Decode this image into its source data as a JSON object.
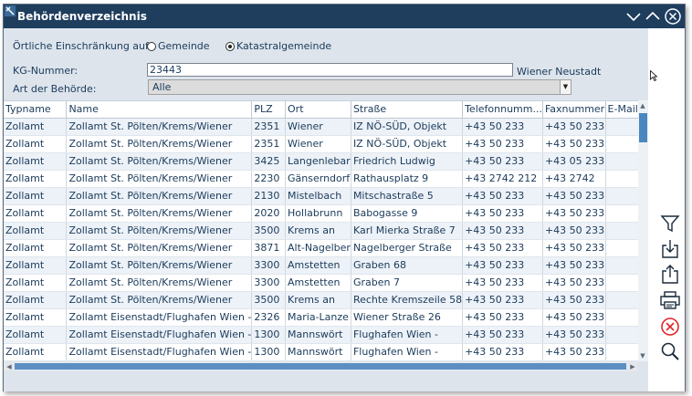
{
  "window": {
    "title": "Behördenverzeichnis"
  },
  "filters": {
    "restriction_label": "Örtliche Einschränkung auf:",
    "radio_gemeinde": "Gemeinde",
    "radio_katastral": "Katastralgemeinde",
    "selected_radio": "Katastralgemeinde",
    "kg_label": "KG-Nummer:",
    "kg_value": "23443",
    "kg_name": "Wiener Neustadt",
    "authority_label": "Art der Behörde:",
    "authority_value": "Alle"
  },
  "table": {
    "columns": [
      "Typname",
      "Name",
      "PLZ",
      "Ort",
      "Straße",
      "Telefonnumm...",
      "Faxnummer",
      "E-Mail"
    ],
    "rows": [
      [
        "Zollamt",
        "Zollamt St. Pölten/Krems/Wiener",
        "2351",
        "Wiener",
        "IZ NÖ-SÜD, Objekt",
        "+43 50 233",
        "+43 50 233",
        ""
      ],
      [
        "Zollamt",
        "Zollamt St. Pölten/Krems/Wiener",
        "2351",
        "Wiener",
        "IZ NÖ-SÜD, Objekt",
        "+43 50 233",
        "+43 50 233",
        ""
      ],
      [
        "Zollamt",
        "Zollamt St. Pölten/Krems/Wiener",
        "3425",
        "Langenlebar",
        "Friedrich Ludwig",
        "+43 50 233",
        "+43 05 233",
        ""
      ],
      [
        "Zollamt",
        "Zollamt St. Pölten/Krems/Wiener",
        "2230",
        "Gänserndorf",
        "Rathausplatz 9",
        "+43 2742 212",
        "+43 2742",
        ""
      ],
      [
        "Zollamt",
        "Zollamt St. Pölten/Krems/Wiener",
        "2130",
        "Mistelbach",
        "Mitschastraße  5",
        "+43 50 233",
        "+43 50 233",
        ""
      ],
      [
        "Zollamt",
        "Zollamt St. Pölten/Krems/Wiener",
        "2020",
        "Hollabrunn",
        "Babogasse 9",
        "+43 50 233",
        "+43 50 233",
        ""
      ],
      [
        "Zollamt",
        "Zollamt St. Pölten/Krems/Wiener",
        "3500",
        "Krems an",
        "Karl Mierka Straße 7",
        "+43 50 233",
        "+43 50 233",
        ""
      ],
      [
        "Zollamt",
        "Zollamt St. Pölten/Krems/Wiener",
        "3871",
        "Alt-Nagelber",
        "Nagelberger Straße",
        "+43 50 233",
        "+43 50 233",
        ""
      ],
      [
        "Zollamt",
        "Zollamt St. Pölten/Krems/Wiener",
        "3300",
        "Amstetten",
        "Graben  68",
        "+43 50 233",
        "+43 50 233",
        ""
      ],
      [
        "Zollamt",
        "Zollamt St. Pölten/Krems/Wiener",
        "3300",
        "Amstetten",
        "Graben 7",
        "+43 50 233",
        "+43 50 233",
        ""
      ],
      [
        "Zollamt",
        "Zollamt St. Pölten/Krems/Wiener",
        "3500",
        "Krems an",
        "Rechte Kremszeile 58",
        "+43 50 233",
        "+43 50 233",
        ""
      ],
      [
        "Zollamt",
        "Zollamt Eisenstadt/Flughafen Wien -",
        "2326",
        "Maria-Lanze",
        "Wiener Straße 26",
        "+43 50 233",
        "+43 50 233",
        ""
      ],
      [
        "Zollamt",
        "Zollamt Eisenstadt/Flughafen Wien -",
        "1300",
        "Mannswört",
        "Flughafen Wien -",
        "+43 50 233",
        "+43 50 233",
        ""
      ],
      [
        "Zollamt",
        "Zollamt Eisenstadt/Flughafen Wien -",
        "1300",
        "Mannswört",
        "Flughafen Wien -",
        "+43 50 233",
        "+43 50 233",
        ""
      ]
    ]
  },
  "toolbar": {
    "icons": [
      "filter-icon",
      "import-icon",
      "export-icon",
      "print-icon",
      "cancel-icon",
      "search-icon"
    ]
  },
  "colors": {
    "titlebar": "#1f3e5e",
    "accent": "#4a87c0",
    "text": "#1a3a5a",
    "cancel": "#e0262a"
  }
}
